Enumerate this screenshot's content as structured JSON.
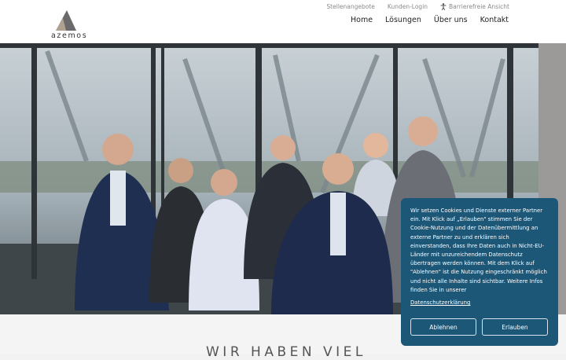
{
  "brand": {
    "name": "azemos",
    "accent": "#555555"
  },
  "utility_nav": {
    "jobs": "Stellenangebote",
    "login": "Kunden-Login",
    "accessibility": "Barrierefreie Ansicht",
    "accessibility_icon": "accessibility-icon"
  },
  "main_nav": [
    "Home",
    "Lösungen",
    "Über uns",
    "Kontakt"
  ],
  "hero": {
    "image": "team-photo"
  },
  "section": {
    "heading": "WIR HABEN VIEL"
  },
  "cookie_banner": {
    "text": "Wir setzen Cookies und Dienste externer Partner ein. Mit Klick auf „Erlauben\" stimmen Sie der Cookie-Nutzung und der Datenübermittlung an externe Partner zu und erklären sich einverstanden, dass Ihre Daten auch in Nicht-EU-Länder mit unzureichendem Datenschutz übertragen werden können. Mit dem Klick auf \"Ablehnen\" ist die Nutzung eingeschränkt möglich und nicht alle Inhalte sind sichtbar. Weitere Infos finden Sie in unserer",
    "link": "Datenschutzerklärung",
    "reject": "Ablehnen",
    "accept": "Erlauben",
    "background": "#1c5778"
  }
}
